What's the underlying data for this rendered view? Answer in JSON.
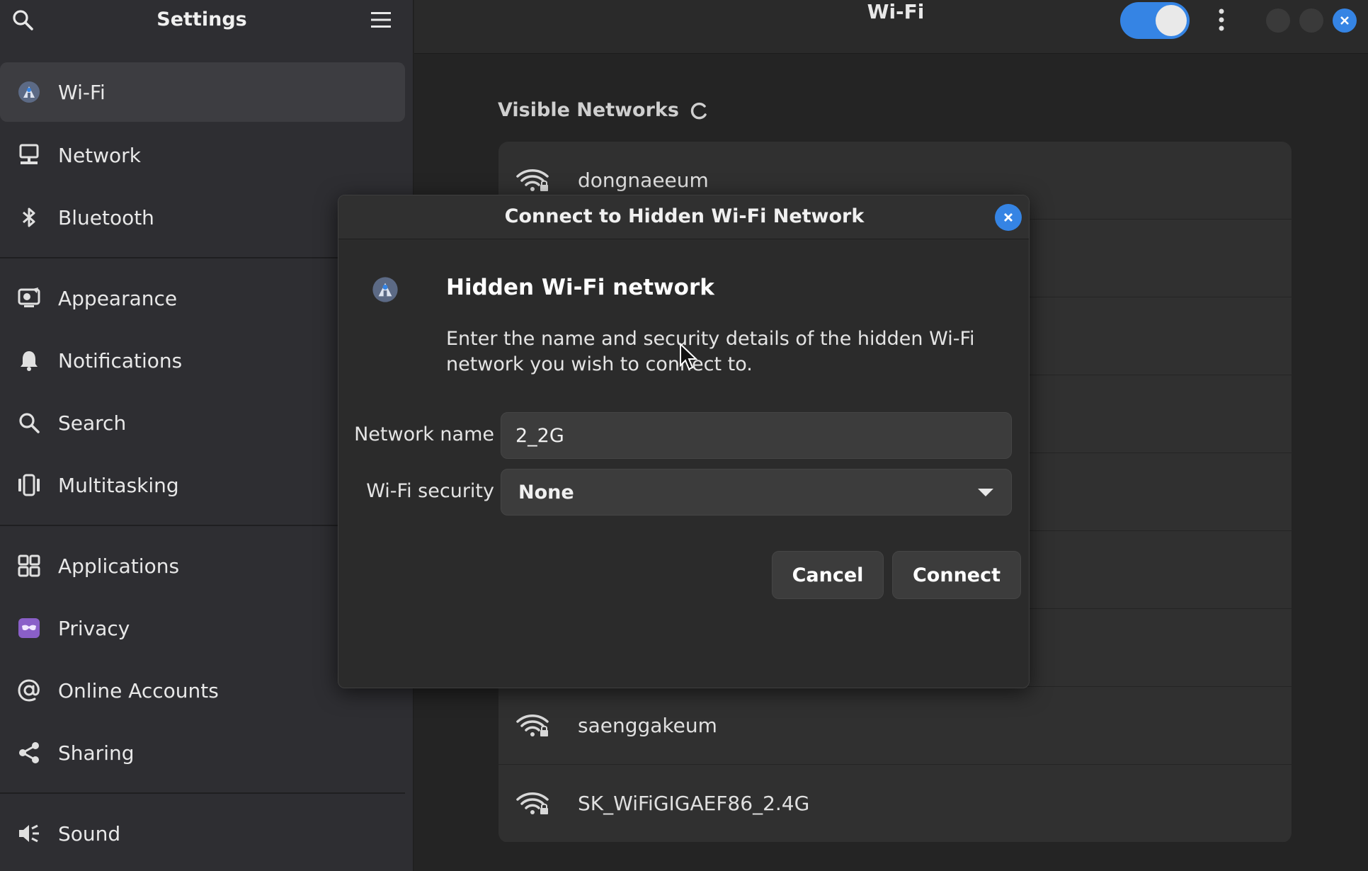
{
  "sidebar": {
    "title": "Settings",
    "items": [
      {
        "label": "Wi-Fi",
        "icon": "wifi-icon",
        "active": true
      },
      {
        "label": "Network",
        "icon": "network-icon"
      },
      {
        "label": "Bluetooth",
        "icon": "bluetooth-icon"
      },
      {
        "label": "Appearance",
        "icon": "appearance-icon"
      },
      {
        "label": "Notifications",
        "icon": "bell-icon"
      },
      {
        "label": "Search",
        "icon": "search-icon"
      },
      {
        "label": "Multitasking",
        "icon": "multitasking-icon"
      },
      {
        "label": "Applications",
        "icon": "grid-icon"
      },
      {
        "label": "Privacy",
        "icon": "privacy-icon"
      },
      {
        "label": "Online Accounts",
        "icon": "at-icon"
      },
      {
        "label": "Sharing",
        "icon": "share-icon"
      },
      {
        "label": "Sound",
        "icon": "speaker-icon"
      }
    ]
  },
  "main": {
    "title": "Wi-Fi",
    "wifi_enabled": true,
    "visible_networks_label": "Visible Networks",
    "networks": [
      {
        "name": "dongnaeeum"
      },
      {
        "name": ""
      },
      {
        "name": ""
      },
      {
        "name": ""
      },
      {
        "name": ""
      },
      {
        "name": ""
      },
      {
        "name": ""
      },
      {
        "name": "saenggakeum"
      },
      {
        "name": "SK_WiFiGIGAEF86_2.4G"
      }
    ]
  },
  "dialog": {
    "title": "Connect to Hidden Wi-Fi Network",
    "heading": "Hidden Wi-Fi network",
    "description": "Enter the name and security details of the hidden Wi-Fi network you wish to connect to.",
    "network_name_label": "Network name",
    "network_name_value": "2_2G",
    "security_label": "Wi-Fi security",
    "security_value": "None",
    "cancel_label": "Cancel",
    "connect_label": "Connect"
  },
  "colors": {
    "accent": "#3584e4",
    "privacy": "#8a5fc8"
  }
}
